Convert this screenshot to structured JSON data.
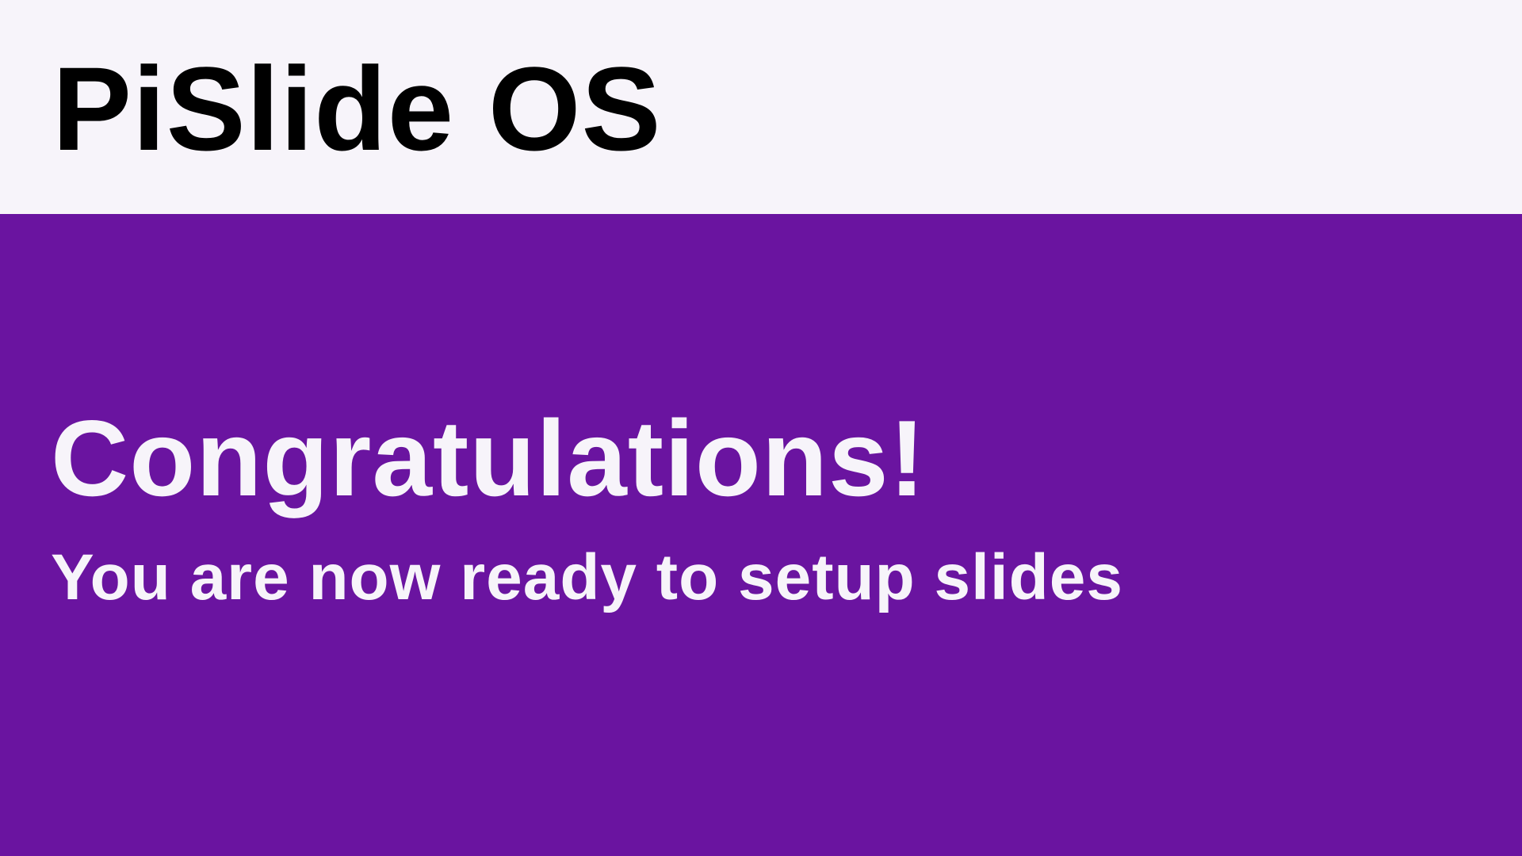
{
  "header": {
    "title": "PiSlide OS"
  },
  "main": {
    "headline": "Congratulations!",
    "subheadline": "You are now ready to setup slides"
  },
  "colors": {
    "header_background": "#f7f4fa",
    "panel_background": "#6a14a0",
    "header_text": "#000000",
    "panel_text": "#f7f4fa"
  }
}
